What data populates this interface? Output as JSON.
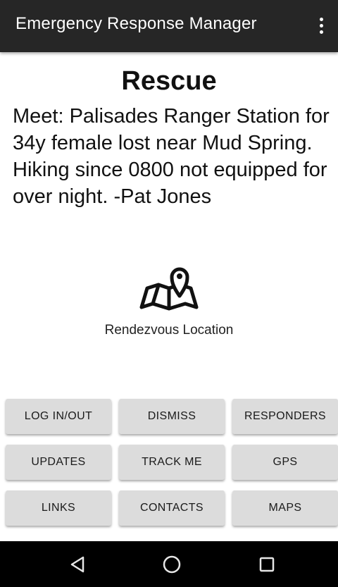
{
  "appbar": {
    "title": "Emergency Response Manager"
  },
  "main": {
    "heading": "Rescue",
    "message": "Meet: Palisades Ranger Station for 34y female lost near Mud Spring. Hiking since 0800 not equipped for over night. -Pat Jones",
    "rendezvous": {
      "icon": "map-pin-icon",
      "label": "Rendezvous Location"
    }
  },
  "buttons": {
    "login": "LOG IN/OUT",
    "dismiss": "DISMISS",
    "responders": "RESPONDERS",
    "updates": "UPDATES",
    "track_me": "TRACK ME",
    "gps": "GPS",
    "links": "LINKS",
    "contacts": "CONTACTS",
    "maps": "MAPS"
  },
  "navbar": {
    "back_icon": "back-triangle-icon",
    "home_icon": "home-circle-icon",
    "recents_icon": "recents-square-icon"
  },
  "colors": {
    "appbar": "#262626",
    "button": "#dcdcdc",
    "navbar": "#000000"
  }
}
